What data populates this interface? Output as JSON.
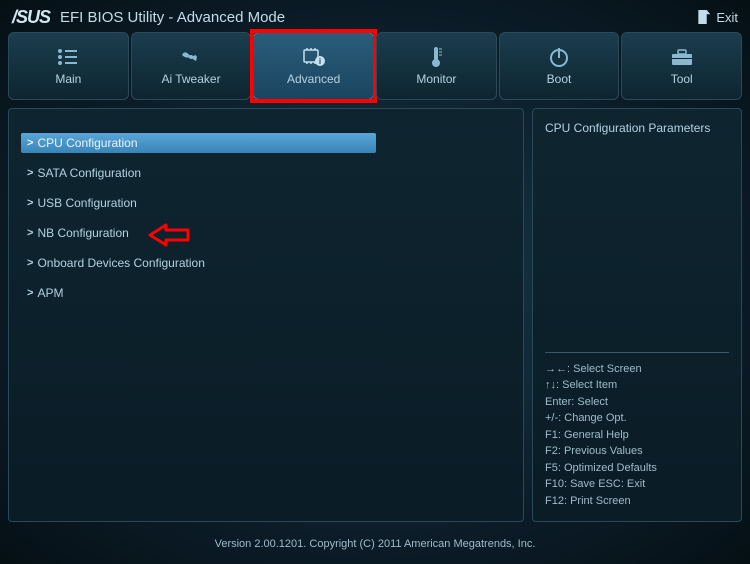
{
  "header": {
    "logo": "/SUS",
    "title": "EFI BIOS Utility - Advanced Mode",
    "exit_label": "Exit"
  },
  "tabs": [
    {
      "label": "Main"
    },
    {
      "label": "Ai  Tweaker"
    },
    {
      "label": "Advanced"
    },
    {
      "label": "Monitor"
    },
    {
      "label": "Boot"
    },
    {
      "label": "Tool"
    }
  ],
  "menu": [
    {
      "label": "CPU Configuration",
      "selected": true
    },
    {
      "label": "SATA Configuration"
    },
    {
      "label": "USB Configuration"
    },
    {
      "label": "NB Configuration"
    },
    {
      "label": "Onboard Devices Configuration"
    },
    {
      "label": "APM"
    }
  ],
  "help": {
    "title": "CPU Configuration Parameters",
    "keys": [
      "→←:  Select Screen",
      "↑↓:   Select Item",
      "Enter:  Select",
      "+/-:  Change Opt.",
      "F1:  General Help",
      "F2:  Previous Values",
      "F5:  Optimized Defaults",
      "F10:  Save   ESC:  Exit",
      "F12:  Print Screen"
    ]
  },
  "footer": "Version  2.00.1201.   Copyright  (C)  2011 American  Megatrends,  Inc."
}
